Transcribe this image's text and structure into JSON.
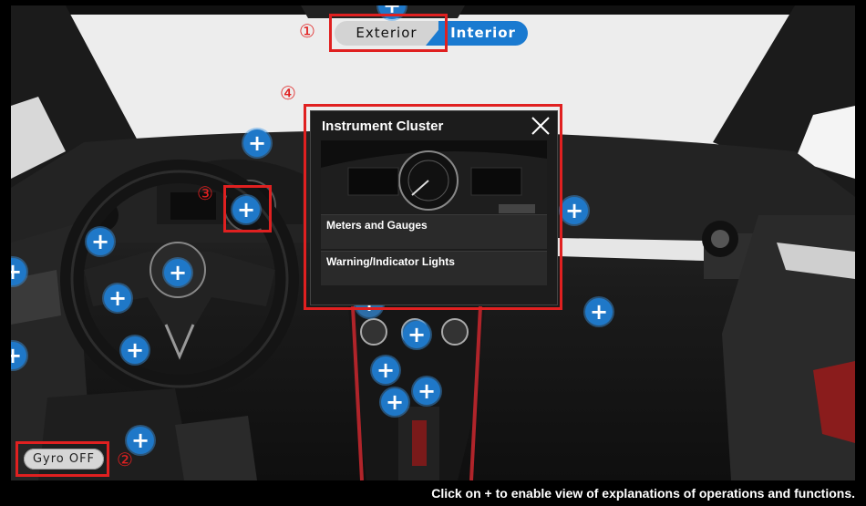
{
  "view_toggle": {
    "exterior_label": "Exterior",
    "interior_label": "Interior",
    "active": "Interior"
  },
  "gyro": {
    "label": "Gyro OFF"
  },
  "popup": {
    "title": "Instrument Cluster",
    "items": [
      {
        "label": "Meters and Gauges"
      },
      {
        "label": "Warning/Indicator Lights"
      }
    ]
  },
  "hotspots": {
    "symbol": "+",
    "count": 18
  },
  "annotations": {
    "one": "①",
    "two": "②",
    "three": "③",
    "four": "④"
  },
  "footer": {
    "note": "Click on + to enable view of explanations of operations and functions."
  },
  "colors": {
    "accent": "#1a7ad0",
    "annotation": "#e02020",
    "hotspot": "#1f78c8"
  },
  "icons": {
    "close": "close-icon"
  }
}
